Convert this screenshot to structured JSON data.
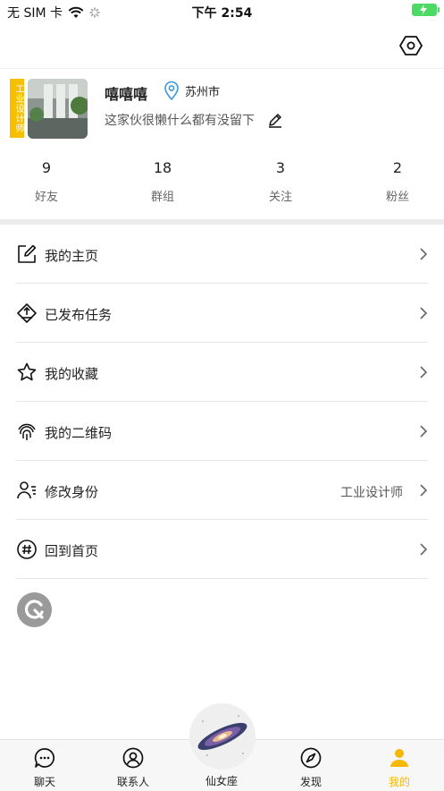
{
  "status_bar": {
    "carrier": "无 SIM 卡",
    "time": "下午 2:54"
  },
  "profile": {
    "badge_text": "工业设计师",
    "username": "嘻嘻嘻",
    "location": "苏州市",
    "bio": "这家伙很懒什么都有没留下"
  },
  "stats": [
    {
      "value": "9",
      "label": "好友"
    },
    {
      "value": "18",
      "label": "群组"
    },
    {
      "value": "3",
      "label": "关注"
    },
    {
      "value": "2",
      "label": "粉丝"
    }
  ],
  "menu": [
    {
      "label": "我的主页",
      "icon": "edit-square-icon"
    },
    {
      "label": "已发布任务",
      "icon": "task-icon"
    },
    {
      "label": "我的收藏",
      "icon": "star-icon"
    },
    {
      "label": "我的二维码",
      "icon": "fingerprint-icon"
    },
    {
      "label": "修改身份",
      "icon": "identity-icon",
      "value": "工业设计师"
    },
    {
      "label": "回到首页",
      "icon": "hashtag-icon"
    }
  ],
  "tabbar": {
    "tabs": [
      {
        "label": "聊天",
        "icon": "chat-icon"
      },
      {
        "label": "联系人",
        "icon": "contacts-icon"
      },
      {
        "label": "仙女座",
        "icon": "galaxy-icon"
      },
      {
        "label": "发现",
        "icon": "compass-icon"
      },
      {
        "label": "我的",
        "icon": "user-icon",
        "active": true
      }
    ]
  },
  "colors": {
    "accent": "#f6b800",
    "badge": "#f6c000",
    "battery": "#4cd964"
  }
}
